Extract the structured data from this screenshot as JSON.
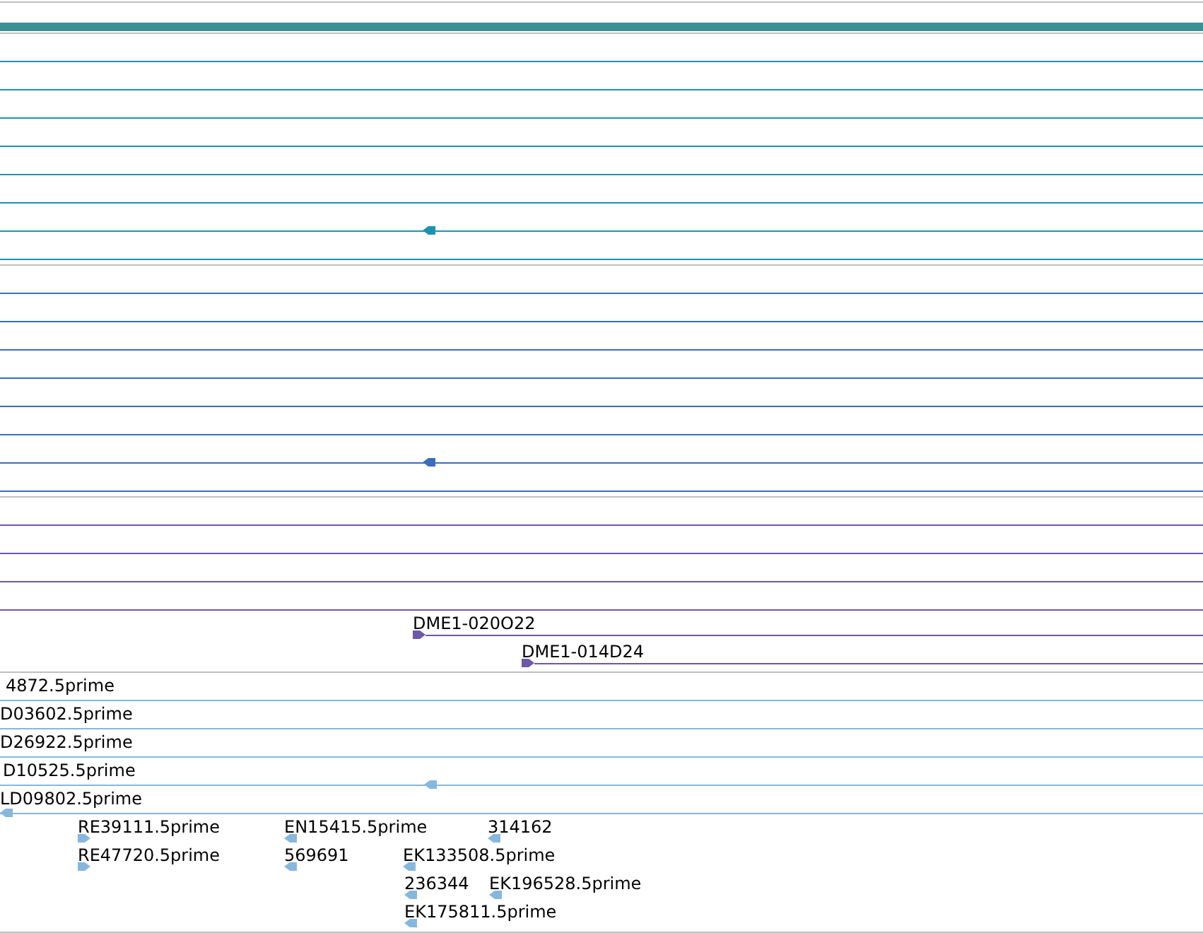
{
  "tracks": [
    {
      "color": "#1b93b3",
      "rows": [
        {
          "kind": "line"
        },
        {
          "kind": "line"
        },
        {
          "kind": "line"
        },
        {
          "kind": "line"
        },
        {
          "kind": "line"
        },
        {
          "kind": "line"
        },
        {
          "kind": "line",
          "features": [
            {
              "arrow": true,
              "reverse": true
            }
          ]
        },
        {
          "kind": "line"
        }
      ]
    },
    {
      "color": "#3a6cc0",
      "rows": [
        {
          "kind": "line"
        },
        {
          "kind": "line"
        },
        {
          "kind": "line"
        },
        {
          "kind": "line"
        },
        {
          "kind": "line"
        },
        {
          "kind": "line"
        },
        {
          "kind": "line",
          "features": [
            {
              "arrow": true,
              "reverse": true
            }
          ]
        },
        {
          "kind": "line"
        }
      ]
    },
    {
      "color": "#6e58a8",
      "rows": [
        {
          "kind": "line"
        },
        {
          "kind": "line"
        },
        {
          "kind": "line"
        },
        {
          "kind": "line"
        },
        {
          "kind": "stack",
          "features": [
            {
              "label": "DME1-020O22",
              "arrow": true,
              "reverse": false,
              "span": true
            }
          ]
        },
        {
          "kind": "stack",
          "features": [
            {
              "label": "DME1-014D24",
              "arrow": true,
              "reverse": false,
              "span": true
            }
          ]
        }
      ]
    },
    {
      "color": "#86b8de",
      "rows": [
        {
          "kind": "line",
          "features": [
            {
              "label": "4872.5prime",
              "arrow": false
            }
          ]
        },
        {
          "kind": "line",
          "features": [
            {
              "label": "D03602.5prime",
              "arrow": false
            }
          ]
        },
        {
          "kind": "line",
          "features": [
            {
              "label": "D26922.5prime",
              "arrow": false
            }
          ]
        },
        {
          "kind": "line",
          "features": [
            {
              "label": "D10525.5prime",
              "arrow": false
            },
            {
              "arrow": true,
              "reverse": true
            }
          ]
        },
        {
          "kind": "line",
          "features": [
            {
              "label": "LD09802.5prime",
              "arrow": true,
              "reverse": true
            }
          ]
        },
        {
          "kind": "stack",
          "features": [
            {
              "label": "RE39111.5prime",
              "arrow": true,
              "reverse": false
            },
            {
              "label": "EN15415.5prime",
              "arrow": true,
              "reverse": true
            },
            {
              "label": "314162",
              "arrow": true,
              "reverse": true
            }
          ]
        },
        {
          "kind": "stack",
          "features": [
            {
              "label": "RE47720.5prime",
              "arrow": true,
              "reverse": false
            },
            {
              "label": "569691",
              "arrow": true,
              "reverse": true
            },
            {
              "label": "EK133508.5prime",
              "arrow": true,
              "reverse": true
            }
          ]
        },
        {
          "kind": "stack",
          "features": [
            {
              "label": "236344",
              "arrow": true,
              "reverse": true
            },
            {
              "label": "EK196528.5prime",
              "arrow": true,
              "reverse": true
            }
          ]
        },
        {
          "kind": "stack",
          "features": [
            {
              "label": "EK175811.5prime",
              "arrow": true,
              "reverse": true
            }
          ]
        }
      ]
    }
  ]
}
